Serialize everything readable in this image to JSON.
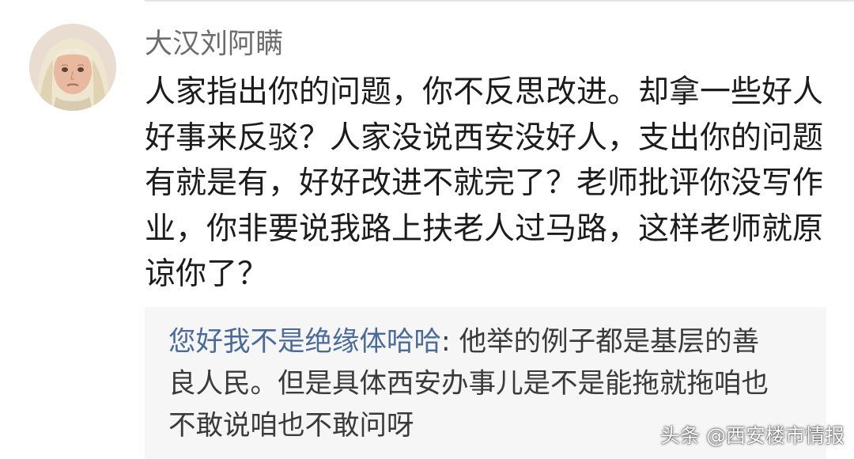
{
  "comment": {
    "username": "大汉刘阿瞒",
    "lines": [
      "人家指出你的问题，你不反思改进。却拿一些好人",
      "好事来反驳？人家没说西安没好人，支出你的问题",
      "有就是有，好好改进不就完了？老师批评你没写作",
      "业，你非要说我路上扶老人过马路，这样老师就原",
      "谅你了？"
    ]
  },
  "reply": {
    "author": "您好我不是绝缘体哈哈",
    "separator": ": ",
    "lines": [
      "他举的例子都是基层的善",
      "良人民。但是具体西安办事儿是不是能拖就拖咱也",
      "不敢说咱也不敢问呀"
    ]
  },
  "watermark": "头条 @西安楼市情报",
  "colors": {
    "reply_author": "#4a6a99",
    "reply_background": "#f6f6f6",
    "username": "#6c6c6c",
    "body_text": "#1c1c1c"
  }
}
